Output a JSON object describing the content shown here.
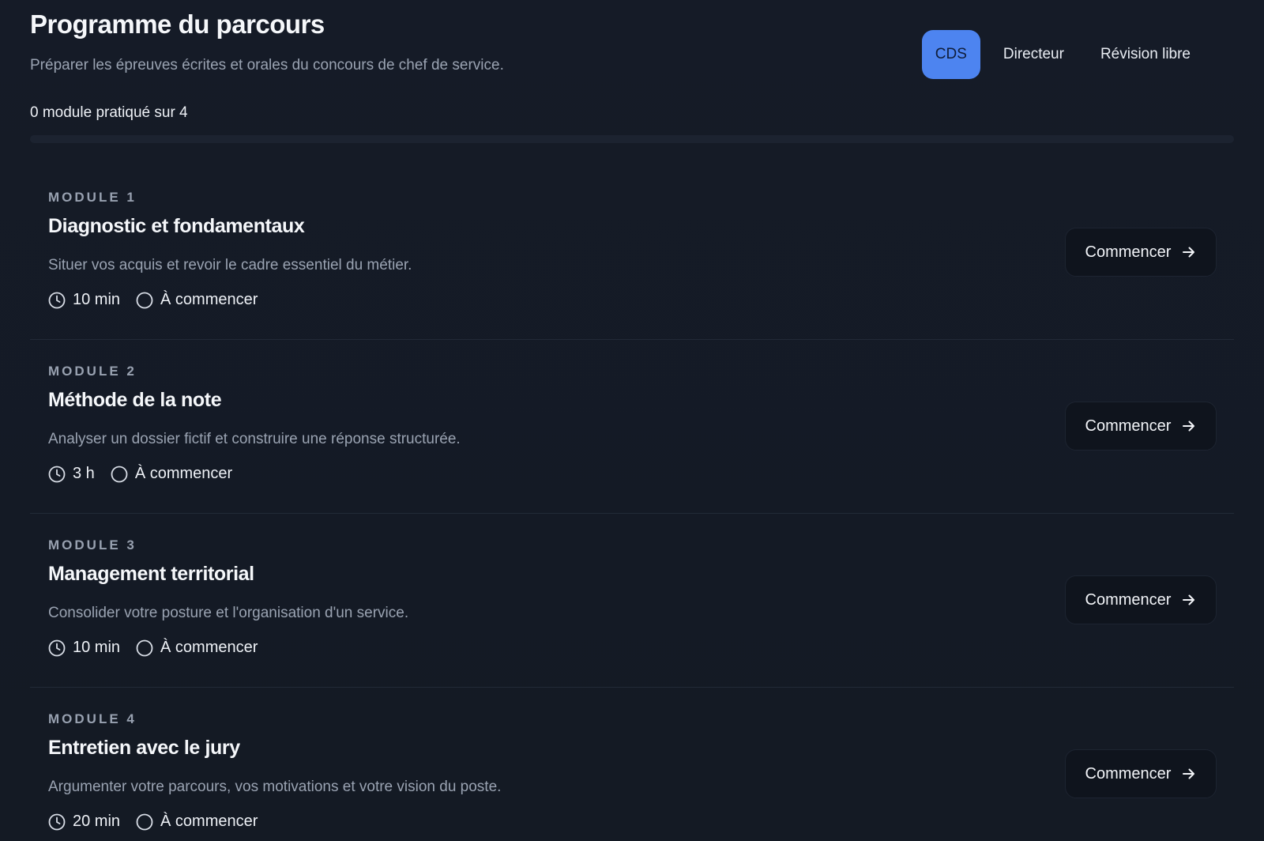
{
  "header": {
    "title": "Programme du parcours",
    "subtitle": "Préparer les épreuves écrites et orales du concours de chef de service."
  },
  "tabs": [
    {
      "label": "CDS",
      "active": true
    },
    {
      "label": "Directeur",
      "active": false
    },
    {
      "label": "Révision libre",
      "active": false
    }
  ],
  "progress": {
    "label": "0 module pratiqué sur 4",
    "completed": 0,
    "total": 4
  },
  "modules": [
    {
      "number": "MODULE 1",
      "title": "Diagnostic et fondamentaux",
      "description": "Situer vos acquis et revoir le cadre essentiel du métier.",
      "duration": "10 min",
      "status": "À commencer",
      "action": "Commencer"
    },
    {
      "number": "MODULE 2",
      "title": "Méthode de la note",
      "description": "Analyser un dossier fictif et construire une réponse structurée.",
      "duration": "3 h",
      "status": "À commencer",
      "action": "Commencer"
    },
    {
      "number": "MODULE 3",
      "title": "Management territorial",
      "description": "Consolider votre posture et l'organisation d'un service.",
      "duration": "10 min",
      "status": "À commencer",
      "action": "Commencer"
    },
    {
      "number": "MODULE 4",
      "title": "Entretien avec le jury",
      "description": "Argumenter votre parcours, vos motivations et votre vision du poste.",
      "duration": "20 min",
      "status": "À commencer",
      "action": "Commencer"
    }
  ],
  "icons": {
    "duration": "clock-icon",
    "status": "circle-outline-icon",
    "action": "arrow-right-icon"
  },
  "colors": {
    "accent": "#4d84f0",
    "background": "#141a25",
    "button_bg": "#0f141d"
  }
}
